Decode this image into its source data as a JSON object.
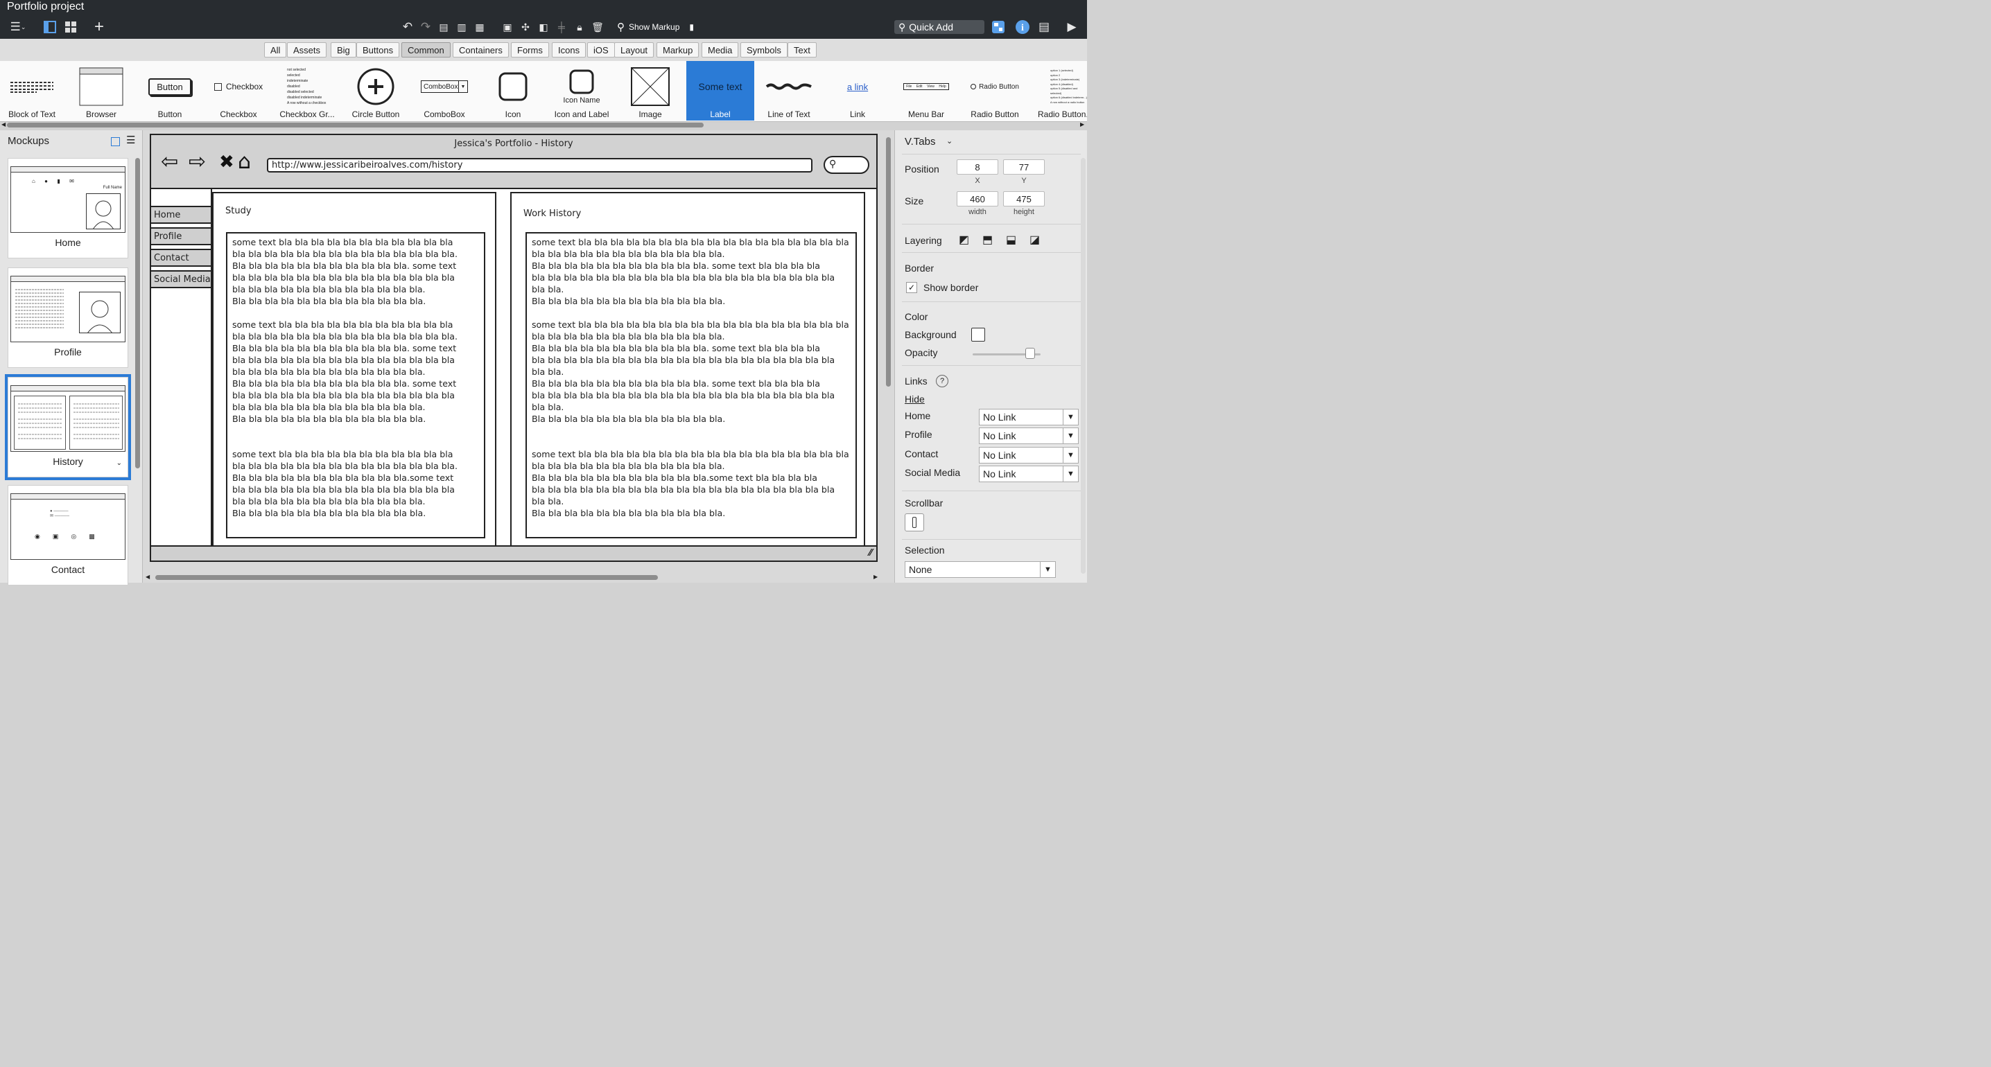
{
  "app_title": "Portfolio project",
  "toolbar": {
    "show_markup": "Show Markup",
    "quick_add": "Quick Add"
  },
  "categories": [
    "All",
    "Assets",
    "Big",
    "Buttons",
    "Common",
    "Containers",
    "Forms",
    "Icons",
    "iOS",
    "Layout",
    "Markup",
    "Media",
    "Symbols",
    "Text"
  ],
  "active_category": "Common",
  "library": [
    {
      "label": "Block of Text"
    },
    {
      "label": "Browser"
    },
    {
      "label": "Button",
      "preview": "Button"
    },
    {
      "label": "Checkbox",
      "preview": "Checkbox"
    },
    {
      "label": "Checkbox Gr...",
      "preview_items": [
        "not selected",
        "selected",
        "indeterminate",
        "disabled",
        "disabled selected",
        "disabled indeterminate",
        "A row without a checkbox"
      ]
    },
    {
      "label": "Circle Button"
    },
    {
      "label": "ComboBox",
      "preview": "ComboBox"
    },
    {
      "label": "Icon"
    },
    {
      "label": "Icon and Label",
      "preview": "Icon Name"
    },
    {
      "label": "Image"
    },
    {
      "label": "Label",
      "preview": "Some text"
    },
    {
      "label": "Line of Text"
    },
    {
      "label": "Link",
      "preview": "a link"
    },
    {
      "label": "Menu Bar",
      "preview_items": [
        "File",
        "Edit",
        "View",
        "Help"
      ]
    },
    {
      "label": "Radio Button",
      "preview": "Radio Button"
    },
    {
      "label": "Radio Button...",
      "preview_items": [
        "option 1 (selected)",
        "option 2",
        "option 3 (indeterminate)",
        "option 4 (disabled)",
        "option 5 (disabled and selected)",
        "option 6 (disabled indeterm...)",
        "A row without a radio button"
      ]
    }
  ],
  "mockups": {
    "title": "Mockups",
    "items": [
      "Home",
      "Profile",
      "History",
      "Contact"
    ],
    "active": "History",
    "thumb_text": "Full Name"
  },
  "mockup": {
    "browser_title": "Jessica's Portfolio - History",
    "url": "http://www.jessicaribeiroalves.com/history",
    "tabs": [
      "Home",
      "Profile",
      "Contact",
      "Social Media"
    ],
    "study_title": "Study",
    "work_title": "Work History",
    "study_text": "some text bla bla bla bla bla bla bla bla bla bla bla\nbla bla bla bla bla bla bla bla bla bla bla bla bla bla.\nBla bla bla bla bla bla bla bla bla bla bla. some text\nbla bla bla bla bla bla bla bla bla bla bla bla bla bla\nbla bla bla bla bla bla bla bla bla bla bla bla.\nBla bla bla bla bla bla bla bla bla bla bla bla.\n\nsome text bla bla bla bla bla bla bla bla bla bla bla\nbla bla bla bla bla bla bla bla bla bla bla bla bla bla.\nBla bla bla bla bla bla bla bla bla bla bla. some text\nbla bla bla bla bla bla bla bla bla bla bla bla bla bla\nbla bla bla bla bla bla bla bla bla bla bla bla.\nBla bla bla bla bla bla bla bla bla bla bla. some text\nbla bla bla bla bla bla bla bla bla bla bla bla bla bla\nbla bla bla bla bla bla bla bla bla bla bla bla.\nBla bla bla bla bla bla bla bla bla bla bla bla.\n\n\nsome text bla bla bla bla bla bla bla bla bla bla bla\nbla bla bla bla bla bla bla bla bla bla bla bla bla bla.\nBla bla bla bla bla bla bla bla bla bla bla.some text\nbla bla bla bla bla bla bla bla bla bla bla bla bla bla\nbla bla bla bla bla bla bla bla bla bla bla bla.\nBla bla bla bla bla bla bla bla bla bla bla bla.",
    "work_text": "some text bla bla bla bla bla bla bla bla bla bla bla bla bla bla bla bla bla\nbla bla bla bla bla bla bla bla bla bla bla bla.\nBla bla bla bla bla bla bla bla bla bla bla. some text bla bla bla bla\nbla bla bla bla bla bla bla bla bla bla bla bla bla bla bla bla bla bla bla\nbla bla.\nBla bla bla bla bla bla bla bla bla bla bla bla.\n\nsome text bla bla bla bla bla bla bla bla bla bla bla bla bla bla bla bla bla\nbla bla bla bla bla bla bla bla bla bla bla bla.\nBla bla bla bla bla bla bla bla bla bla bla. some text bla bla bla bla\nbla bla bla bla bla bla bla bla bla bla bla bla bla bla bla bla bla bla bla\nbla bla.\nBla bla bla bla bla bla bla bla bla bla bla. some text bla bla bla bla\nbla bla bla bla bla bla bla bla bla bla bla bla bla bla bla bla bla bla bla\nbla bla.\nBla bla bla bla bla bla bla bla bla bla bla bla.\n\n\nsome text bla bla bla bla bla bla bla bla bla bla bla bla bla bla bla bla bla\nbla bla bla bla bla bla bla bla bla bla bla bla.\nBla bla bla bla bla bla bla bla bla bla bla.some text bla bla bla bla\nbla bla bla bla bla bla bla bla bla bla bla bla bla bla bla bla bla bla bla\nbla bla.\nBla bla bla bla bla bla bla bla bla bla bla bla."
  },
  "inspector": {
    "title": "V.Tabs",
    "position_label": "Position",
    "x": "8",
    "y": "77",
    "x_label": "X",
    "y_label": "Y",
    "size_label": "Size",
    "width": "460",
    "height": "475",
    "width_label": "width",
    "height_label": "height",
    "layering_label": "Layering",
    "border_label": "Border",
    "show_border": "Show border",
    "color_label": "Color",
    "background_label": "Background",
    "opacity_label": "Opacity",
    "opacity_value": 0.85,
    "links_label": "Links",
    "hide_label": "Hide",
    "links": [
      {
        "name": "Home",
        "value": "No Link"
      },
      {
        "name": "Profile",
        "value": "No Link"
      },
      {
        "name": "Contact",
        "value": "No Link"
      },
      {
        "name": "Social Media",
        "value": "No Link"
      }
    ],
    "scrollbar_label": "Scrollbar",
    "selection_label": "Selection",
    "selection_value": "None"
  },
  "colors": {
    "accent": "#2b7bd6",
    "topbar": "#282c30"
  }
}
